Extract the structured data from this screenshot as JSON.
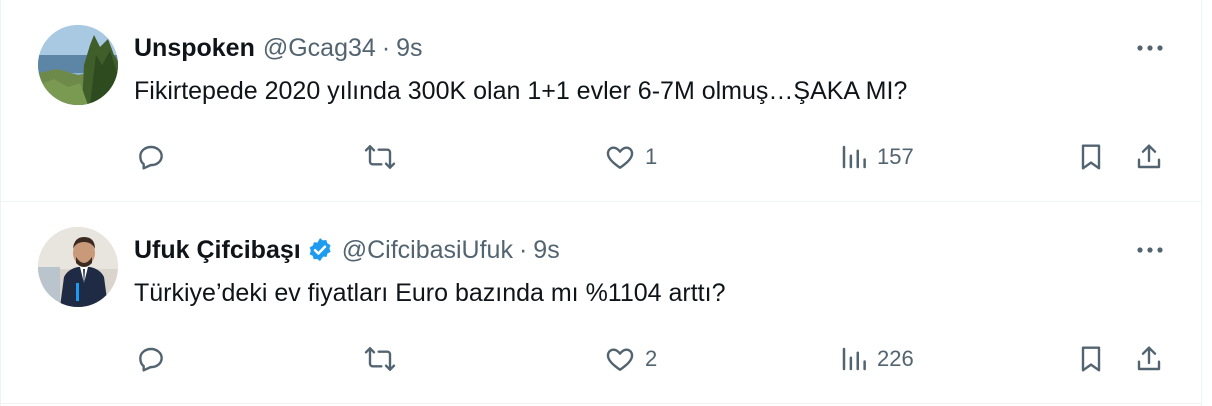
{
  "tweets": [
    {
      "author_name": "Unspoken",
      "handle": "@Gcag34",
      "separator": "·",
      "time": "9s",
      "verified": false,
      "text": "Fikirtepede 2020 yılında 300K olan 1+1 evler 6-7M olmuş…ŞAKA MI?",
      "replies": "",
      "retweets": "",
      "likes": "1",
      "views": "157"
    },
    {
      "author_name": "Ufuk Çifcibaşı",
      "handle": "@CifcibasiUfuk",
      "separator": "·",
      "time": "9s",
      "verified": true,
      "text": "Türkiye’deki ev fiyatları Euro bazında mı %1104 arttı?",
      "replies": "",
      "retweets": "",
      "likes": "2",
      "views": "226"
    }
  ],
  "colors": {
    "text_primary": "#0f1419",
    "text_secondary": "#536471",
    "verified_badge": "#1d9bf0",
    "divider": "#eff3f4"
  },
  "icons": [
    "avatar-landscape",
    "avatar-person",
    "verified-badge-icon",
    "more-icon",
    "reply-icon",
    "retweet-icon",
    "like-icon",
    "views-icon",
    "bookmark-icon",
    "share-icon"
  ]
}
